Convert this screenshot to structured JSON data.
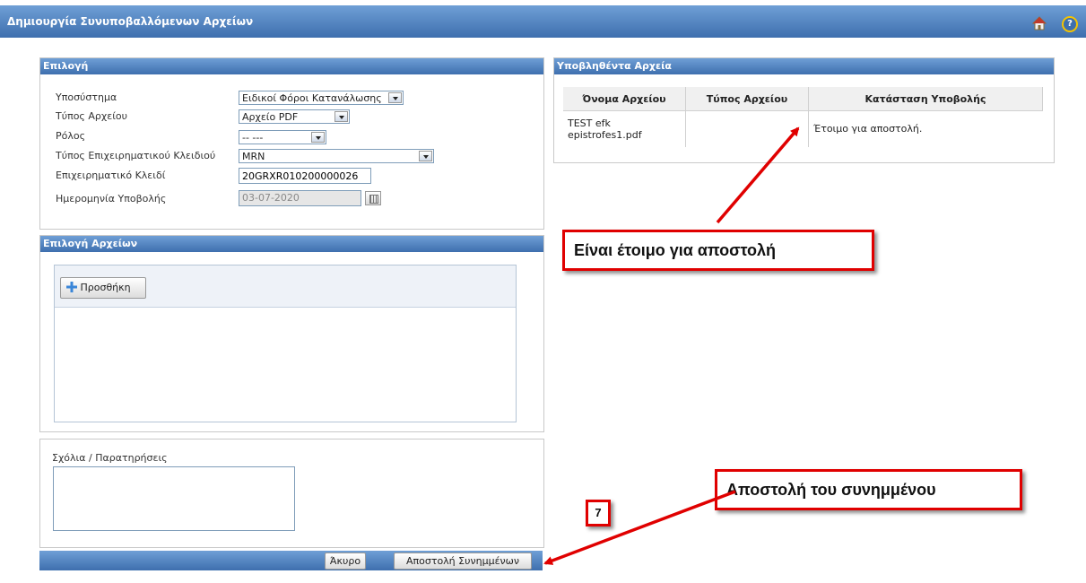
{
  "window": {
    "title": "Δημιουργία Συνυποβαλλόμενων Αρχείων",
    "home_icon": "home-icon",
    "help_icon": "help-icon",
    "help_glyph": "?"
  },
  "selection": {
    "header": "Επιλογή",
    "fields": {
      "subsystem": {
        "label": "Υποσύστημα",
        "value": "Ειδικοί Φόροι Κατανάλωσης"
      },
      "file_type": {
        "label": "Τύπος Αρχείου",
        "value": "Αρχείο PDF"
      },
      "role": {
        "label": "Ρόλος",
        "value": "-- ---"
      },
      "business_key_type": {
        "label": "Τύπος Επιχειρηματικού Κλειδιού",
        "value": "MRN"
      },
      "business_key": {
        "label": "Επιχειρηματικό Κλειδί",
        "value": "20GRXR010200000026"
      },
      "submission_date": {
        "label": "Ημερομηνία Υποβολής",
        "value": "03-07-2020"
      }
    }
  },
  "file_selection": {
    "header": "Επιλογή Αρχείων",
    "add_label": "Προσθήκη"
  },
  "comments": {
    "label": "Σχόλια / Παρατηρήσεις",
    "value": ""
  },
  "submitted_files": {
    "header": "Υποβληθέντα Αρχεία",
    "columns": [
      "Όνομα Αρχείου",
      "Τύπος Αρχείου",
      "Κατάσταση Υποβολής"
    ],
    "rows": [
      {
        "name_line1": "TEST efk",
        "name_line2": "epistrofes1.pdf",
        "type": "",
        "status": "Έτοιμο για αποστολή."
      }
    ]
  },
  "footer": {
    "cancel_label": "Άκυρο",
    "send_label": "Αποστολή Συνημμένων"
  },
  "annotations": {
    "ready_callout": "Είναι έτοιμο για αποστολή",
    "send_callout": "Αποστολή του συνημμένου",
    "step_number": "7",
    "callout_border_color": "#e00000",
    "arrow_color": "#e00000"
  }
}
